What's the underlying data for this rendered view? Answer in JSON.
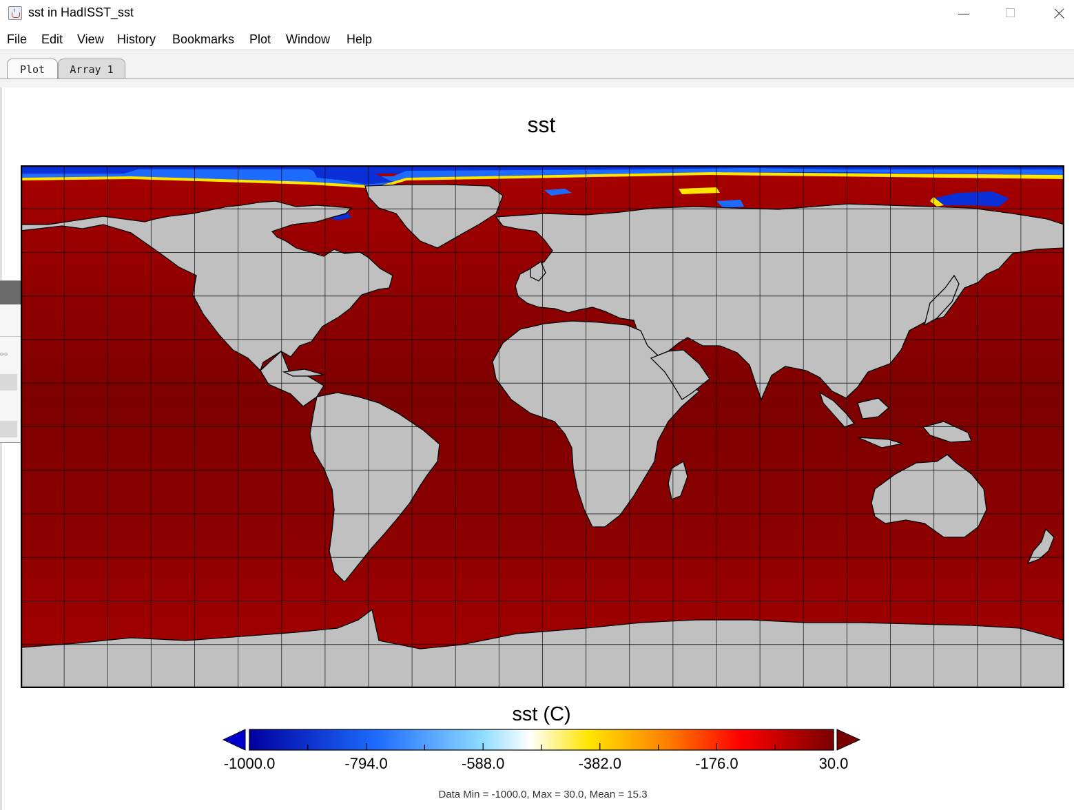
{
  "window": {
    "title": "sst in HadISST_sst",
    "icon": "java-cup-icon"
  },
  "menu": [
    "File",
    "Edit",
    "View",
    "History",
    "Bookmarks",
    "Plot",
    "Window",
    "Help"
  ],
  "tabs": [
    {
      "label": "Plot",
      "active": true
    },
    {
      "label": "Array 1",
      "active": false
    }
  ],
  "plot": {
    "title": "sst",
    "projection": "equirectangular world map",
    "land_color": "#c0c0c0",
    "grid": true,
    "colorbar": {
      "label": "sst (C)",
      "min": -1000.0,
      "max": 30.0,
      "tick_labels": [
        "-1000.0",
        "-794.0",
        "-588.0",
        "-382.0",
        "-176.0",
        "30.0"
      ],
      "colors": [
        "#0000a0",
        "#1e6cff",
        "#8fdcff",
        "#ffffff",
        "#ffe600",
        "#ff7a00",
        "#ff0000",
        "#7a0000"
      ],
      "extend": "both"
    },
    "stats": "Data Min = -1000.0, Max = 30.0, Mean = 15.3"
  }
}
